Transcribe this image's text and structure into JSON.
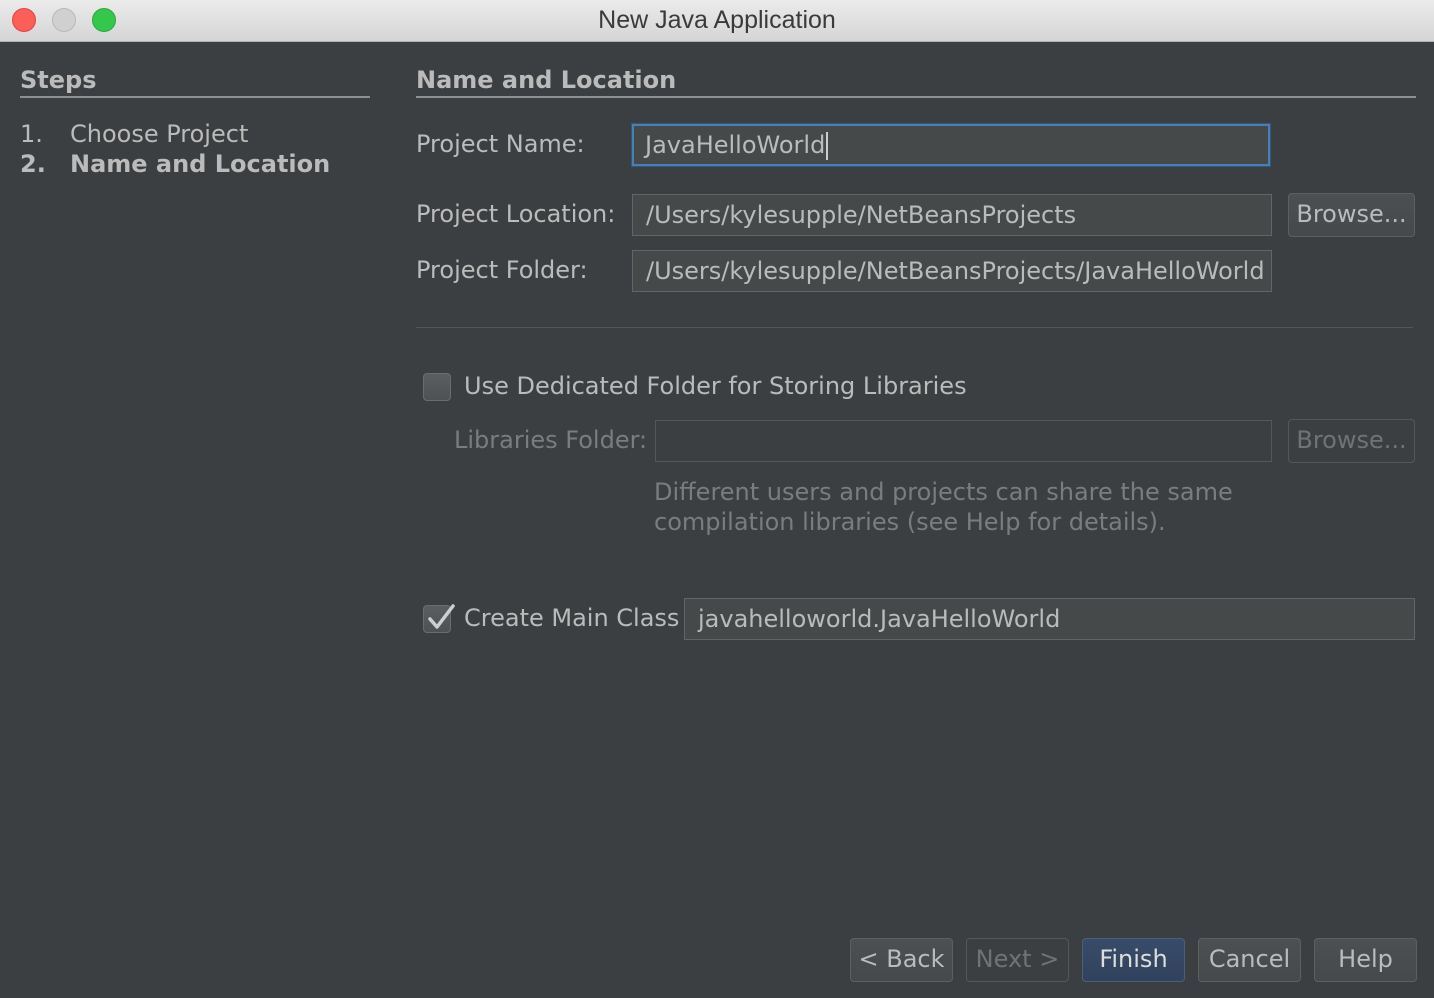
{
  "window": {
    "title": "New Java Application"
  },
  "steps": {
    "header": "Steps",
    "items": [
      {
        "num": "1.",
        "label": "Choose Project"
      },
      {
        "num": "2.",
        "label": "Name and Location"
      }
    ]
  },
  "panel": {
    "header": "Name and Location",
    "project_name": {
      "label": "Project Name:",
      "value": "JavaHelloWorld"
    },
    "project_location": {
      "label": "Project Location:",
      "value": "/Users/kylesupple/NetBeansProjects",
      "browse": "Browse..."
    },
    "project_folder": {
      "label": "Project Folder:",
      "value": "/Users/kylesupple/NetBeansProjects/JavaHelloWorld"
    },
    "dedicated_folder": {
      "label": "Use Dedicated Folder for Storing Libraries",
      "checked": false
    },
    "libraries_folder": {
      "label": "Libraries Folder:",
      "value": "",
      "browse": "Browse..."
    },
    "help_text": [
      "Different users and projects can share the same",
      "compilation libraries (see Help for details)."
    ],
    "main_class": {
      "label": "Create Main Class",
      "checked": true,
      "value": "javahelloworld.JavaHelloWorld"
    }
  },
  "buttons": {
    "back": "< Back",
    "next": "Next >",
    "finish": "Finish",
    "cancel": "Cancel",
    "help": "Help"
  }
}
